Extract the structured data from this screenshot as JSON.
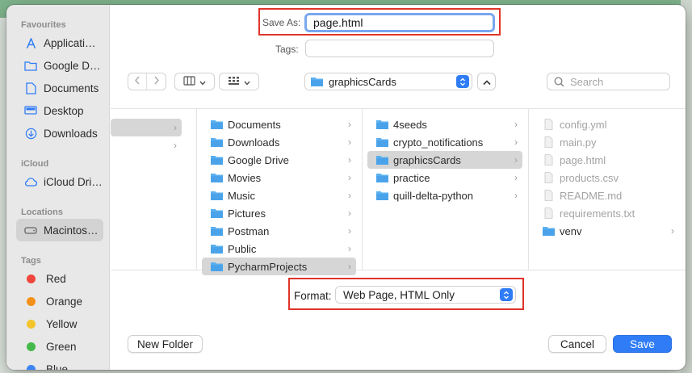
{
  "background": {
    "page": "#dfe6df",
    "strip": "#7fb48c"
  },
  "sidebar": {
    "sections": {
      "favourites": "Favourites",
      "icloud": "iCloud",
      "locations": "Locations",
      "tags": "Tags"
    },
    "favourites": [
      {
        "label": "Applicati…",
        "icon": "applications-icon"
      },
      {
        "label": "Google D…",
        "icon": "folder-icon"
      },
      {
        "label": "Documents",
        "icon": "document-icon"
      },
      {
        "label": "Desktop",
        "icon": "desktop-icon"
      },
      {
        "label": "Downloads",
        "icon": "download-icon"
      }
    ],
    "icloud": [
      {
        "label": "iCloud Dri…",
        "icon": "cloud-icon"
      }
    ],
    "locations": [
      {
        "label": "Macintos…",
        "icon": "disk-icon",
        "selected": true
      }
    ],
    "tags": [
      {
        "label": "Red",
        "color": "#f0463d"
      },
      {
        "label": "Orange",
        "color": "#f39019"
      },
      {
        "label": "Yellow",
        "color": "#f3c52b"
      },
      {
        "label": "Green",
        "color": "#45b94b"
      },
      {
        "label": "Blue",
        "color": "#3a84f5"
      }
    ]
  },
  "save_as": {
    "label": "Save As:",
    "value": "page.html"
  },
  "tags_field": {
    "label": "Tags:",
    "value": ""
  },
  "toolbar": {
    "location": "graphicsCards",
    "search_placeholder": "Search"
  },
  "browser": {
    "column1": [
      {
        "label": "Documents",
        "icon": "folder-icon"
      },
      {
        "label": "Downloads",
        "icon": "folder-icon"
      },
      {
        "label": "Google Drive",
        "icon": "folder-icon"
      },
      {
        "label": "Movies",
        "icon": "folder-icon"
      },
      {
        "label": "Music",
        "icon": "folder-icon"
      },
      {
        "label": "Pictures",
        "icon": "folder-icon"
      },
      {
        "label": "Postman",
        "icon": "folder-icon"
      },
      {
        "label": "Public",
        "icon": "folder-icon"
      },
      {
        "label": "PycharmProjects",
        "icon": "folder-icon",
        "selected": true
      }
    ],
    "column2": [
      {
        "label": "4seeds",
        "icon": "folder-icon"
      },
      {
        "label": "crypto_notifications",
        "icon": "folder-icon"
      },
      {
        "label": "graphicsCards",
        "icon": "folder-icon",
        "selected": true
      },
      {
        "label": "practice",
        "icon": "folder-icon"
      },
      {
        "label": "quill-delta-python",
        "icon": "folder-icon"
      }
    ],
    "column3": [
      {
        "label": "config.yml",
        "icon": "file-icon",
        "dim": true
      },
      {
        "label": "main.py",
        "icon": "file-icon",
        "dim": true
      },
      {
        "label": "page.html",
        "icon": "file-icon",
        "dim": true
      },
      {
        "label": "products.csv",
        "icon": "file-icon",
        "dim": true
      },
      {
        "label": "README.md",
        "icon": "file-icon",
        "dim": true
      },
      {
        "label": "requirements.txt",
        "icon": "file-icon",
        "dim": true
      },
      {
        "label": "venv",
        "icon": "folder-icon"
      }
    ]
  },
  "format": {
    "label": "Format:",
    "value": "Web Page, HTML Only"
  },
  "buttons": {
    "new_folder": "New Folder",
    "cancel": "Cancel",
    "save": "Save"
  },
  "colors": {
    "accent": "#2f7cf6",
    "highlight_border": "#e0342a",
    "folder": "#5ab0f0"
  }
}
